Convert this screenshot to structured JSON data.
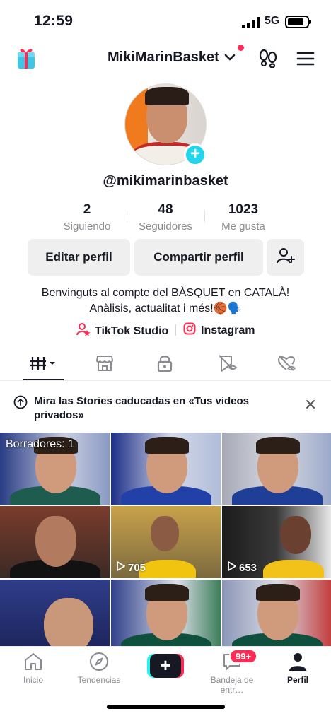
{
  "status_bar": {
    "time": "12:59",
    "network": "5G"
  },
  "header": {
    "username": "MikiMarinBasket"
  },
  "profile": {
    "handle": "@mikimarinbasket",
    "stats": [
      {
        "value": "2",
        "label": "Siguiendo"
      },
      {
        "value": "48",
        "label": "Seguidores"
      },
      {
        "value": "1023",
        "label": "Me gusta"
      }
    ],
    "edit_label": "Editar perfil",
    "share_label": "Compartir perfil",
    "bio_line1": "Benvinguts al compte del BÀSQUET en CATALÀ!",
    "bio_line2": "Anàlisis, actualitat i més!🏀🗣️",
    "link_studio": "TikTok Studio",
    "link_instagram": "Instagram"
  },
  "notice": {
    "text": "Mira las Stories caducadas en «Tus videos privados»"
  },
  "grid": {
    "draft_label": "Borradores: 1",
    "views": [
      "705",
      "653"
    ]
  },
  "nav": {
    "home": "Inicio",
    "discover": "Tendencias",
    "inbox": "Bandeja de entr…",
    "inbox_badge": "99+",
    "profile": "Perfil"
  },
  "colors": {
    "accent": "#fe2c55",
    "cyan": "#20d5ec",
    "text": "#161823",
    "muted": "#8a8b91"
  }
}
